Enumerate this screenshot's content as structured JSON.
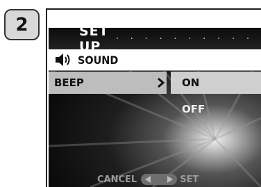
{
  "step": {
    "number": "2"
  },
  "menu": {
    "title": "SET UP",
    "title_dots": "· · · · · · · · · · · ·",
    "section_label": "SOUND",
    "section_icon": "speaker-icon",
    "item": {
      "label": "BEEP",
      "chevron": ">"
    },
    "options": [
      {
        "label": "ON",
        "selected": true
      },
      {
        "label": "OFF",
        "selected": false
      }
    ]
  },
  "footer": {
    "cancel_label": "CANCEL",
    "set_label": "SET",
    "left_icon": "left-arrow-icon",
    "right_icon": "right-arrow-icon"
  },
  "colors": {
    "badge_bg": "#d8d8d8",
    "title_bar": "#111111",
    "highlight": "#bdbdbd",
    "footer_text": "#9a9a9a"
  }
}
